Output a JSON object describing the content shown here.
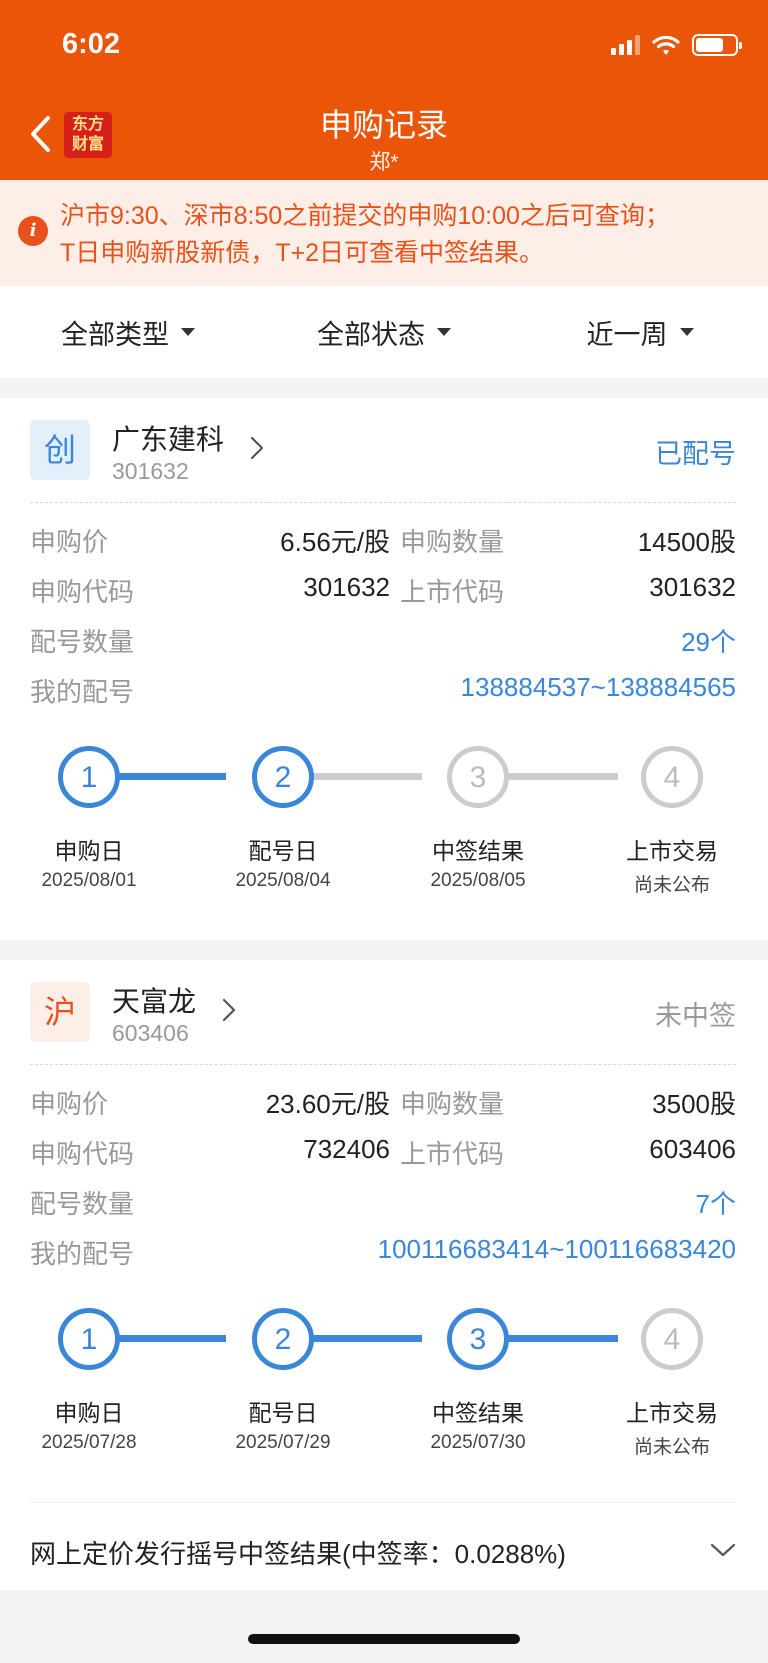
{
  "status_bar": {
    "time": "6:02"
  },
  "nav": {
    "title": "申购记录",
    "subtitle": "郑*",
    "logo_line1": "东方",
    "logo_line2": "财富"
  },
  "notice": {
    "line1": "沪市9:30、深市8:50之前提交的申购10:00之后可查询；",
    "line2": "T日申购新股新债，T+2日可查看中签结果。"
  },
  "filters": [
    {
      "label": "全部类型"
    },
    {
      "label": "全部状态"
    },
    {
      "label": "近一周"
    }
  ],
  "records": [
    {
      "badge": "创",
      "name": "广东建科",
      "code": "301632",
      "status": "已配号",
      "price_label": "申购价",
      "price": "6.56元/股",
      "qty_label": "申购数量",
      "qty": "14500股",
      "sub_code_label": "申购代码",
      "sub_code": "301632",
      "list_code_label": "上市代码",
      "list_code": "301632",
      "alloc_count_label": "配号数量",
      "alloc_count": "29个",
      "my_alloc_label": "我的配号",
      "my_alloc": "138884537~138884565",
      "steps": [
        {
          "num": "1",
          "label": "申购日",
          "date": "2025/08/01"
        },
        {
          "num": "2",
          "label": "配号日",
          "date": "2025/08/04"
        },
        {
          "num": "3",
          "label": "中签结果",
          "date": "2025/08/05"
        },
        {
          "num": "4",
          "label": "上市交易",
          "date": "尚未公布"
        }
      ],
      "steps_completed": 2
    },
    {
      "badge": "沪",
      "name": "天富龙",
      "code": "603406",
      "status": "未中签",
      "price_label": "申购价",
      "price": "23.60元/股",
      "qty_label": "申购数量",
      "qty": "3500股",
      "sub_code_label": "申购代码",
      "sub_code": "732406",
      "list_code_label": "上市代码",
      "list_code": "603406",
      "alloc_count_label": "配号数量",
      "alloc_count": "7个",
      "my_alloc_label": "我的配号",
      "my_alloc": "100116683414~100116683420",
      "steps": [
        {
          "num": "1",
          "label": "申购日",
          "date": "2025/07/28"
        },
        {
          "num": "2",
          "label": "配号日",
          "date": "2025/07/29"
        },
        {
          "num": "3",
          "label": "中签结果",
          "date": "2025/07/30"
        },
        {
          "num": "4",
          "label": "上市交易",
          "date": "尚未公布"
        }
      ],
      "steps_completed": 3,
      "result_text": "网上定价发行摇号中签结果(中签率：0.0288%)"
    }
  ],
  "colors": {
    "brand": "#ea5507",
    "accent_blue": "#3a86d8",
    "notice_text": "#e8521a"
  }
}
